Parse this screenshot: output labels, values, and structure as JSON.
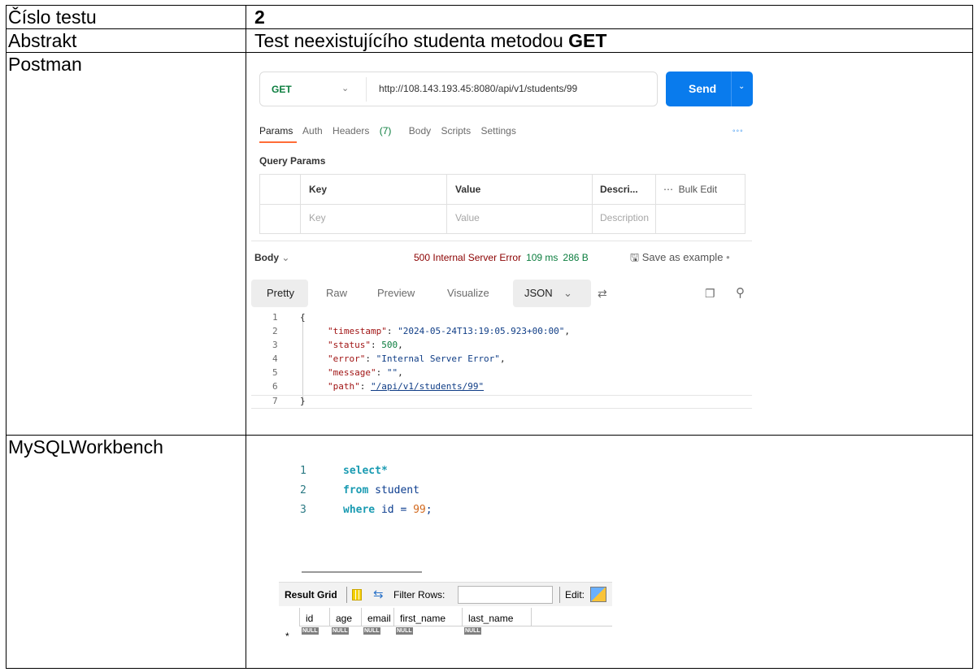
{
  "rows": [
    {
      "label": "Číslo testu",
      "value": "2"
    },
    {
      "label": "Abstrakt",
      "value_prefix": "Test neexistujícího studenta metodou ",
      "value_bold": "GET"
    },
    {
      "label": "Postman"
    },
    {
      "label": "MySQLWorkbench"
    }
  ],
  "postman": {
    "method": "GET",
    "url": "http://108.143.193.45:8080/api/v1/students/99",
    "send_label": "Send",
    "tabs": [
      "Params",
      "Auth",
      "Headers",
      "Body",
      "Scripts",
      "Settings"
    ],
    "headers_count": "(7)",
    "query_params_label": "Query Params",
    "grid_headers": {
      "key": "Key",
      "value": "Value",
      "description": "Descri...",
      "bulk_edit": "Bulk Edit"
    },
    "grid_placeholders": {
      "key": "Key",
      "value": "Value",
      "description": "Description"
    },
    "body_label": "Body",
    "status": "500 Internal Server Error",
    "time": "109 ms",
    "size": "286 B",
    "save_example": "Save as example",
    "view_modes": [
      "Pretty",
      "Raw",
      "Preview",
      "Visualize"
    ],
    "format": "JSON",
    "response_lines": [
      {
        "n": "1",
        "text": "{"
      },
      {
        "n": "2",
        "key": "\"timestamp\"",
        "val": "\"2024-05-24T13:19:05.923+00:00\"",
        "trail": ","
      },
      {
        "n": "3",
        "key": "\"status\"",
        "num": "500",
        "trail": ","
      },
      {
        "n": "4",
        "key": "\"error\"",
        "val": "\"Internal Server Error\"",
        "trail": ","
      },
      {
        "n": "5",
        "key": "\"message\"",
        "val": "\"\"",
        "trail": ","
      },
      {
        "n": "6",
        "key": "\"path\"",
        "val": "\"/api/v1/students/99\"",
        "trail": ""
      },
      {
        "n": "7",
        "text": "}"
      }
    ]
  },
  "workbench": {
    "sql_lines": [
      {
        "n": "1",
        "kw": "select",
        "rest": "*",
        "lit": ""
      },
      {
        "n": "2",
        "kw": "from",
        "rest": " student",
        "lit": ""
      },
      {
        "n": "3",
        "kw": "where",
        "rest": " id = ",
        "lit": "99",
        "end": ";"
      }
    ],
    "toolbar": {
      "result_grid": "Result Grid",
      "filter_rows": "Filter Rows:",
      "edit": "Edit:"
    },
    "columns": [
      "id",
      "age",
      "email",
      "first_name",
      "last_name"
    ],
    "null_label": "NULL",
    "new_row_marker": "*"
  }
}
